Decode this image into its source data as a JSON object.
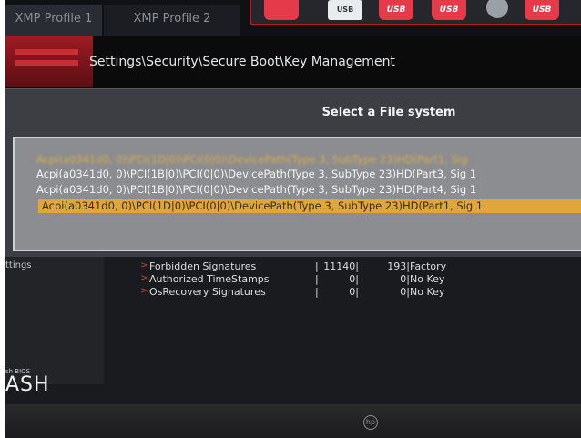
{
  "tabs": [
    "XMP Profile 1",
    "XMP Profile 2"
  ],
  "boot_devices": [
    {
      "kind": "red",
      "label": ""
    },
    {
      "kind": "usb",
      "label": "USB"
    },
    {
      "kind": "red",
      "label": "USB"
    },
    {
      "kind": "red",
      "label": "USB"
    },
    {
      "kind": "disc",
      "label": ""
    },
    {
      "kind": "red",
      "label": "USB"
    }
  ],
  "breadcrumb": "Settings\\Security\\Secure Boot\\Key Management",
  "dialog": {
    "title": "Select a File system",
    "entries": [
      {
        "text": "Acpi(a0341d0, 0)\\PCI(1D|0)\\PCI(0|0)\\DevicePath(Type 3, SubType 23)HD(Part1, Sig",
        "state": "blurred"
      },
      {
        "text": "Acpi(a0341d0, 0)\\PCI(1B|0)\\PCI(0|0)\\DevicePath(Type 3, SubType 23)HD(Part3, Sig 1",
        "state": "normal"
      },
      {
        "text": "Acpi(a0341d0, 0)\\PCI(1B|0)\\PCI(0|0)\\DevicePath(Type 3, SubType 23)HD(Part4, Sig 1",
        "state": "normal"
      },
      {
        "text": "Acpi(a0341d0, 0)\\PCI(1D|0)\\PCI(0|0)\\DevicePath(Type 3, SubType 23)HD(Part1, Sig 1",
        "state": "selected"
      }
    ]
  },
  "sidebar": {
    "label": "ttings",
    "flash_small": "sh BIOS",
    "flash_big": "ASH"
  },
  "key_rows": [
    {
      "name": "Forbidden  Signatures",
      "sep": "|",
      "count": "11140|",
      "size": "193|",
      "status": "Factory"
    },
    {
      "name": "Authorized TimeStamps",
      "sep": "|",
      "count": "0|",
      "size": "0|",
      "status": "No Key"
    },
    {
      "name": "OsRecovery Signatures",
      "sep": "|",
      "count": "0|",
      "size": "0|",
      "status": "No Key"
    }
  ],
  "bezel_logo": "hp",
  "colors": {
    "accent_red": "#b11b28",
    "highlight_amber": "#dfa73a",
    "dialog_bg": "#3c3e43",
    "list_bg": "#8b8d90"
  }
}
